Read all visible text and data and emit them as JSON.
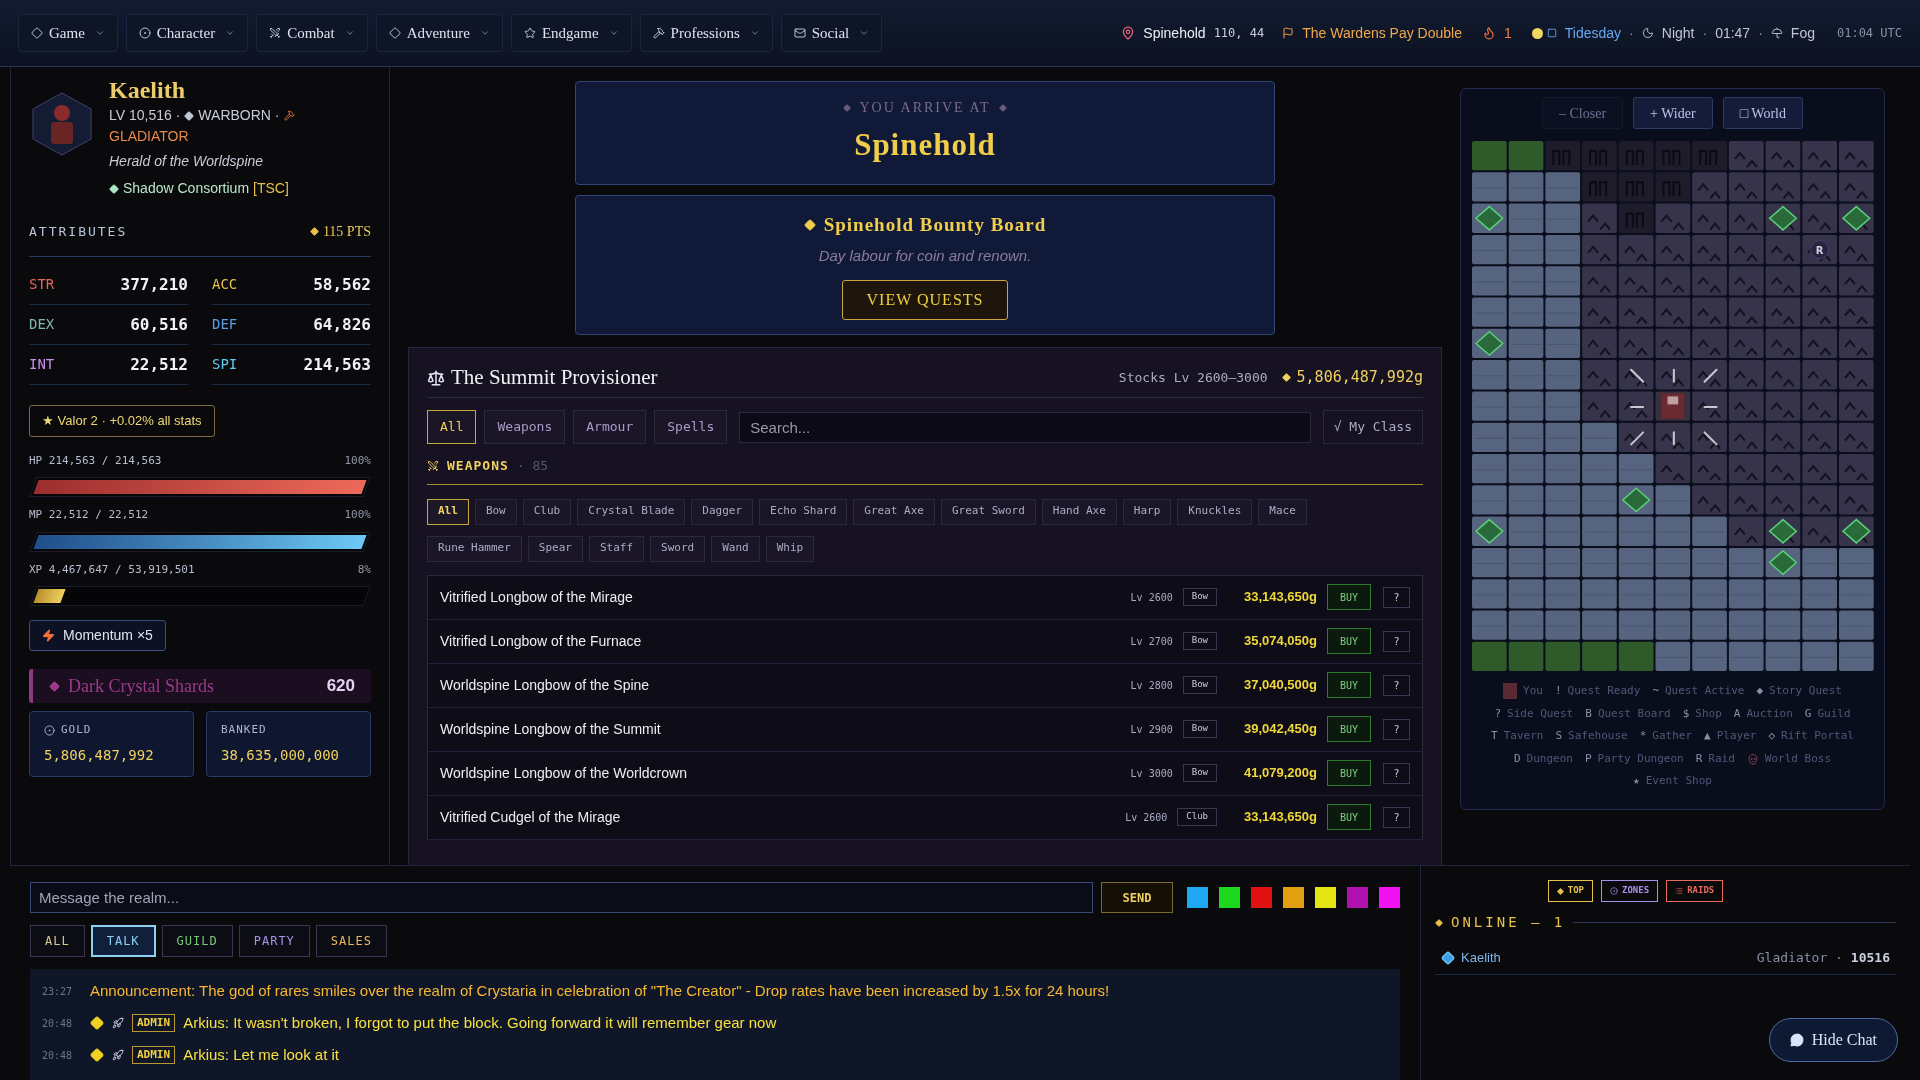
{
  "nav": [
    {
      "label": "Game"
    },
    {
      "label": "Character"
    },
    {
      "label": "Combat"
    },
    {
      "label": "Adventure"
    },
    {
      "label": "Endgame"
    },
    {
      "label": "Professions"
    },
    {
      "label": "Social"
    }
  ],
  "status": {
    "location": "Spinehold",
    "coords": "110, 44",
    "event": "The Wardens Pay Double",
    "streak": "1",
    "separator": "·",
    "weather": [
      {
        "kind": "day",
        "text": "Tidesday"
      },
      {
        "kind": "night",
        "text": "Night"
      },
      {
        "kind": "time",
        "text": "01:47"
      },
      {
        "kind": "fog",
        "text": "Fog"
      }
    ],
    "utc": "01:04 UTC"
  },
  "character": {
    "name": "Kaelith",
    "level": "LV 10,516 ·",
    "race": "WARBORN ·",
    "class": "GLADIATOR",
    "title": "Herald of the Worldspine",
    "guild": "Shadow Consortium",
    "guild_tag": "[TSC]"
  },
  "attributes": {
    "title": "ATTRIBUTES",
    "points": "115 PTS",
    "stats": [
      {
        "name": "STR",
        "value": "377,210",
        "color": "#e8655c"
      },
      {
        "name": "ACC",
        "value": "58,562",
        "color": "#e8c04a"
      },
      {
        "name": "DEX",
        "value": "60,516",
        "color": "#7fb8a8"
      },
      {
        "name": "DEF",
        "value": "64,826",
        "color": "#5a9fe8"
      },
      {
        "name": "INT",
        "value": "22,512",
        "color": "#c890f0"
      },
      {
        "name": "SPI",
        "value": "214,563",
        "color": "#62c8ee"
      }
    ]
  },
  "valor": "★ Valor 2 · +0.02% all stats",
  "bars": [
    {
      "kind": "hp",
      "label": "HP 214,563 / 214,563",
      "percent": "100%",
      "level": 1
    },
    {
      "kind": "mp",
      "label": "MP 22,512 / 22,512",
      "percent": "100%",
      "level": 1
    },
    {
      "kind": "xp",
      "label": "XP 4,467,647 / 53,919,501",
      "percent": "8%",
      "level": 0.083
    }
  ],
  "momentum": "Momentum ×5",
  "shards": {
    "label": "Dark Crystal Shards",
    "value": "620"
  },
  "wallet": [
    {
      "kind": "gold",
      "label": "GOLD",
      "value": "5,806,487,992"
    },
    {
      "kind": "bank",
      "label": "BANKED",
      "value": "38,635,000,000"
    }
  ],
  "arrival": {
    "caption": "YOU ARRIVE AT",
    "place": "Spinehold"
  },
  "board": {
    "title": "Spinehold Bounty Board",
    "subtitle": "Day labour for coin and renown.",
    "button": "VIEW QUESTS"
  },
  "shop": {
    "title": "The Summit Provisioner",
    "stocks": "Stocks Lv 2600–3000",
    "gold": "5,806,487,992g",
    "tabs": [
      {
        "label": "All",
        "selected": true
      },
      {
        "label": "Weapons",
        "selected": false
      },
      {
        "label": "Armour",
        "selected": false
      },
      {
        "label": "Spells",
        "selected": false
      }
    ],
    "search": {
      "placeholder": "Search..."
    },
    "my_class": {
      "label": "√ My Class",
      "on": false
    },
    "section": {
      "title": "WEAPONS",
      "count": "· 85"
    },
    "filters": [
      {
        "label": "All",
        "selected": true
      },
      {
        "label": "Bow",
        "selected": false
      },
      {
        "label": "Club",
        "selected": false
      },
      {
        "label": "Crystal Blade",
        "selected": false
      },
      {
        "label": "Dagger",
        "selected": false
      },
      {
        "label": "Echo Shard",
        "selected": false
      },
      {
        "label": "Great Axe",
        "selected": false
      },
      {
        "label": "Great Sword",
        "selected": false
      },
      {
        "label": "Hand Axe",
        "selected": false
      },
      {
        "label": "Harp",
        "selected": false
      },
      {
        "label": "Knuckles",
        "selected": false
      },
      {
        "label": "Mace",
        "selected": false
      },
      {
        "label": "Rune Hammer",
        "selected": false
      },
      {
        "label": "Spear",
        "selected": false
      },
      {
        "label": "Staff",
        "selected": false
      },
      {
        "label": "Sword",
        "selected": false
      },
      {
        "label": "Wand",
        "selected": false
      },
      {
        "label": "Whip",
        "selected": false
      }
    ],
    "items": [
      {
        "name": "Vitrified Longbow of the Mirage",
        "level": "Lv 2600",
        "type": "Bow",
        "price": "33,143,650g",
        "buy": "BUY",
        "info": "?"
      },
      {
        "name": "Vitrified Longbow of the Furnace",
        "level": "Lv 2700",
        "type": "Bow",
        "price": "35,074,050g",
        "buy": "BUY",
        "info": "?"
      },
      {
        "name": "Worldspine Longbow of the Spine",
        "level": "Lv 2800",
        "type": "Bow",
        "price": "37,040,500g",
        "buy": "BUY",
        "info": "?"
      },
      {
        "name": "Worldspine Longbow of the Summit",
        "level": "Lv 2900",
        "type": "Bow",
        "price": "39,042,450g",
        "buy": "BUY",
        "info": "?"
      },
      {
        "name": "Worldspine Longbow of the Worldcrown",
        "level": "Lv 3000",
        "type": "Bow",
        "price": "41,079,200g",
        "buy": "BUY",
        "info": "?"
      },
      {
        "name": "Vitrified Cudgel of the Mirage",
        "level": "Lv 2600",
        "type": "Club",
        "price": "33,143,650g",
        "buy": "BUY",
        "info": "?"
      }
    ]
  },
  "map": {
    "buttons": [
      {
        "label": "– Closer",
        "disabled": true
      },
      {
        "label": "+ Wider",
        "disabled": false
      },
      {
        "label": "□ World",
        "disabled": false
      }
    ],
    "raid_marker": "R",
    "legend": [
      {
        "kind": "sprite",
        "label": "You"
      },
      {
        "kind": "glyph",
        "symbol": "!",
        "label": "Quest Ready"
      },
      {
        "kind": "glyph",
        "symbol": "~",
        "label": "Quest Active"
      },
      {
        "kind": "glyph",
        "symbol": "◆",
        "label": "Story Quest"
      },
      {
        "kind": "glyph",
        "symbol": "?",
        "label": "Side Quest"
      },
      {
        "kind": "glyph",
        "symbol": "B",
        "label": "Quest Board"
      },
      {
        "kind": "glyph",
        "symbol": "$",
        "label": "Shop"
      },
      {
        "kind": "glyph",
        "symbol": "A",
        "label": "Auction"
      },
      {
        "kind": "glyph",
        "symbol": "G",
        "label": "Guild"
      },
      {
        "kind": "glyph",
        "symbol": "T",
        "label": "Tavern"
      },
      {
        "kind": "glyph",
        "symbol": "S",
        "label": "Safehouse"
      },
      {
        "kind": "glyph",
        "symbol": "*",
        "label": "Gather"
      },
      {
        "kind": "glyph",
        "symbol": "▲",
        "label": "Player"
      },
      {
        "kind": "glyph",
        "symbol": "◇",
        "label": "Rift Portal"
      },
      {
        "kind": "glyph",
        "symbol": "D",
        "label": "Dungeon"
      },
      {
        "kind": "glyph",
        "symbol": "P",
        "label": "Party Dungeon"
      },
      {
        "kind": "glyph",
        "symbol": "R",
        "label": "Raid"
      },
      {
        "kind": "skull",
        "label": "World Boss"
      },
      {
        "kind": "glyph",
        "symbol": "★",
        "label": "Event Shop"
      }
    ]
  },
  "chat": {
    "placeholder": "Message the realm...",
    "send": "SEND",
    "colors": [
      {
        "color": "#1ea8f2"
      },
      {
        "color": "#1ed81e"
      },
      {
        "color": "#e01212"
      },
      {
        "color": "#e0a012"
      },
      {
        "color": "#e4e412"
      },
      {
        "color": "#b012b0"
      },
      {
        "color": "#f012f0"
      }
    ],
    "channels": [
      {
        "label": "ALL",
        "color": "#d8c890",
        "selected": false
      },
      {
        "label": "TALK",
        "color": "#8ed0f4",
        "selected": true
      },
      {
        "label": "GUILD",
        "color": "#78c878",
        "selected": false
      },
      {
        "label": "PARTY",
        "color": "#a890e8",
        "selected": false
      },
      {
        "label": "SALES",
        "color": "#e8b860",
        "selected": false
      }
    ],
    "messages": [
      {
        "kind": "announcement",
        "time": "23:27",
        "text": "Announcement: The god of rares smiles over the realm of Crystaria in celebration of \"The Creator\" - Drop rates have been increased by 1.5x for 24 hours!"
      },
      {
        "kind": "admin",
        "time": "20:48",
        "badge": "ADMIN",
        "text": "Arkius: It wasn't broken, I forgot to put the block. Going forward it will remember gear now"
      },
      {
        "kind": "admin",
        "time": "20:48",
        "badge": "ADMIN",
        "text": "Arkius: Let me look at it"
      }
    ]
  },
  "online": {
    "buttons": [
      {
        "label": "TOP",
        "color": "#e8c04a"
      },
      {
        "label": "ZONES",
        "color": "#a890e8"
      },
      {
        "label": "RAIDS",
        "color": "#e86a5a"
      }
    ],
    "title": "ONLINE – 1",
    "players": [
      {
        "name": "Kaelith",
        "class": "Gladiator ·",
        "level": "10516"
      }
    ],
    "hide_chat": "Hide Chat"
  }
}
